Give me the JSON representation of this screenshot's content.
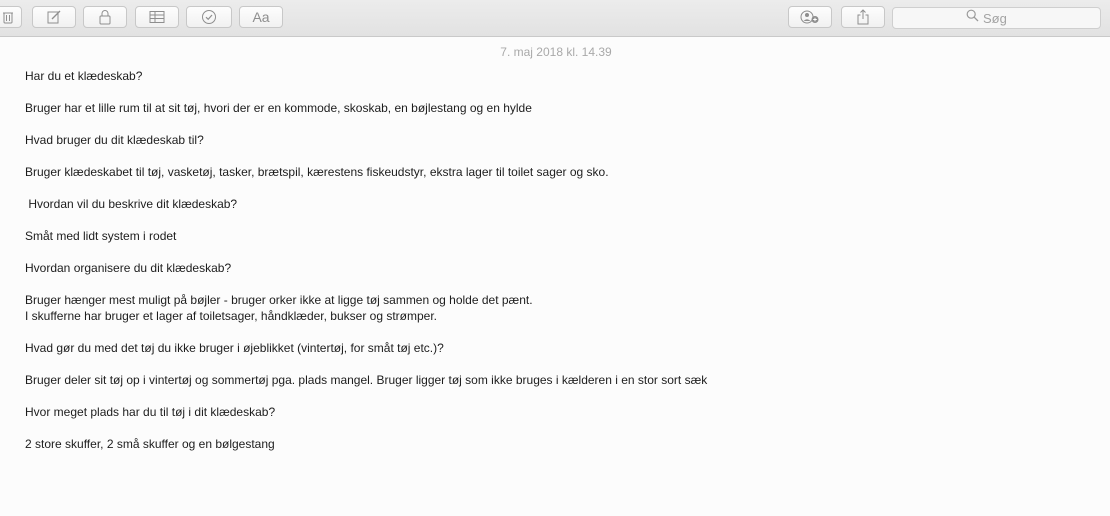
{
  "toolbar": {
    "icons": [
      "trash-icon",
      "compose-icon",
      "lock-icon",
      "table-icon",
      "checklist-icon",
      "font-icon",
      "share-people-icon",
      "share-icon",
      "search-icon"
    ],
    "font_label": "Aa",
    "search_placeholder": "Søg"
  },
  "note": {
    "timestamp": "7. maj 2018 kl. 14.39",
    "paragraphs": [
      "Har du et klædeskab?",
      "Bruger har et lille rum til at sit tøj, hvori der er en kommode, skoskab, en bøjlestang og en hylde",
      "Hvad bruger du dit klædeskab til?",
      "Bruger klædeskabet til tøj, vasketøj, tasker, brætspil, kærestens fiskeudstyr, ekstra lager til toilet sager og sko.",
      " Hvordan vil du beskrive dit klædeskab?",
      "Småt med lidt system i rodet",
      "Hvordan organisere du dit klædeskab?",
      "Bruger hænger mest muligt på bøjler - bruger orker ikke at ligge tøj sammen og holde det pænt.\nI skufferne har bruger et lager af toiletsager, håndklæder, bukser og strømper.",
      "Hvad gør du med det tøj du ikke bruger i øjeblikket (vintertøj, for småt tøj etc.)?",
      "Bruger deler sit tøj op i vintertøj og sommertøj pga. plads mangel. Bruger ligger tøj som ikke bruges i kælderen i en stor sort sæk",
      "Hvor meget plads har du til tøj i dit klædeskab?",
      "2 store skuffer, 2 små skuffer og en bølgestang"
    ]
  }
}
